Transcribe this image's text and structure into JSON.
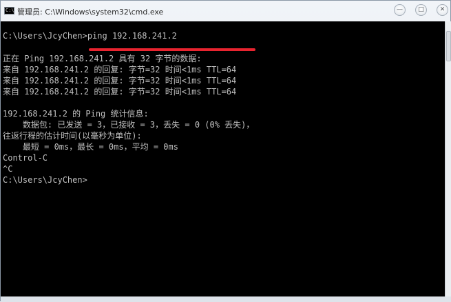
{
  "window": {
    "title": "管理员: C:\\Windows\\system32\\cmd.exe",
    "icon": "cmd-icon",
    "controls": {
      "minimize": "minimize-icon",
      "maximize": "maximize-icon",
      "close": "close-icon"
    },
    "colors": {
      "console_bg": "#000000",
      "console_fg": "#c0c0c0",
      "highlight": "#e8242f"
    }
  },
  "console": {
    "lines": [
      "C:\\Users\\JcyChen>ping 192.168.241.2",
      "",
      "正在 Ping 192.168.241.2 具有 32 字节的数据:",
      "来自 192.168.241.2 的回复: 字节=32 时间<1ms TTL=64",
      "来自 192.168.241.2 的回复: 字节=32 时间<1ms TTL=64",
      "来自 192.168.241.2 的回复: 字节=32 时间<1ms TTL=64",
      "",
      "192.168.241.2 的 Ping 统计信息:",
      "    数据包: 已发送 = 3，已接收 = 3，丢失 = 0 (0% 丢失)，",
      "往返行程的估计时间(以毫秒为单位):",
      "    最短 = 0ms，最长 = 0ms，平均 = 0ms",
      "Control-C",
      "^C",
      "C:\\Users\\JcyChen>"
    ]
  }
}
